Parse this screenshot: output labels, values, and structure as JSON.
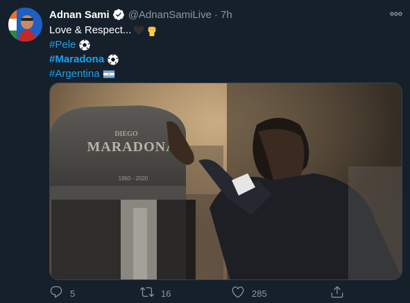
{
  "author": {
    "name": "Adnan Sami",
    "handle": "@AdnanSamiLive",
    "separator": "·",
    "time": "7h",
    "verified": true
  },
  "tweet": {
    "line1": "Love & Respect...",
    "hashtags": [
      "#Pele",
      "#Maradona",
      "#Argentina"
    ]
  },
  "media": {
    "gravestone_line1": "DIEGO",
    "gravestone_line2": "MARADONA",
    "gravestone_dates": "1960 - 2020"
  },
  "actions": {
    "replies": "5",
    "retweets": "16",
    "likes": "285"
  },
  "colors": {
    "background": "#15202b",
    "link": "#1da1f2",
    "muted": "#8899a6",
    "border": "#38444d"
  },
  "icons": [
    "more-icon",
    "verified-icon",
    "black-heart-icon",
    "raised-fist-icon",
    "soccer-ball-icon",
    "argentina-flag-icon",
    "reply-icon",
    "retweet-icon",
    "like-icon",
    "share-icon"
  ]
}
